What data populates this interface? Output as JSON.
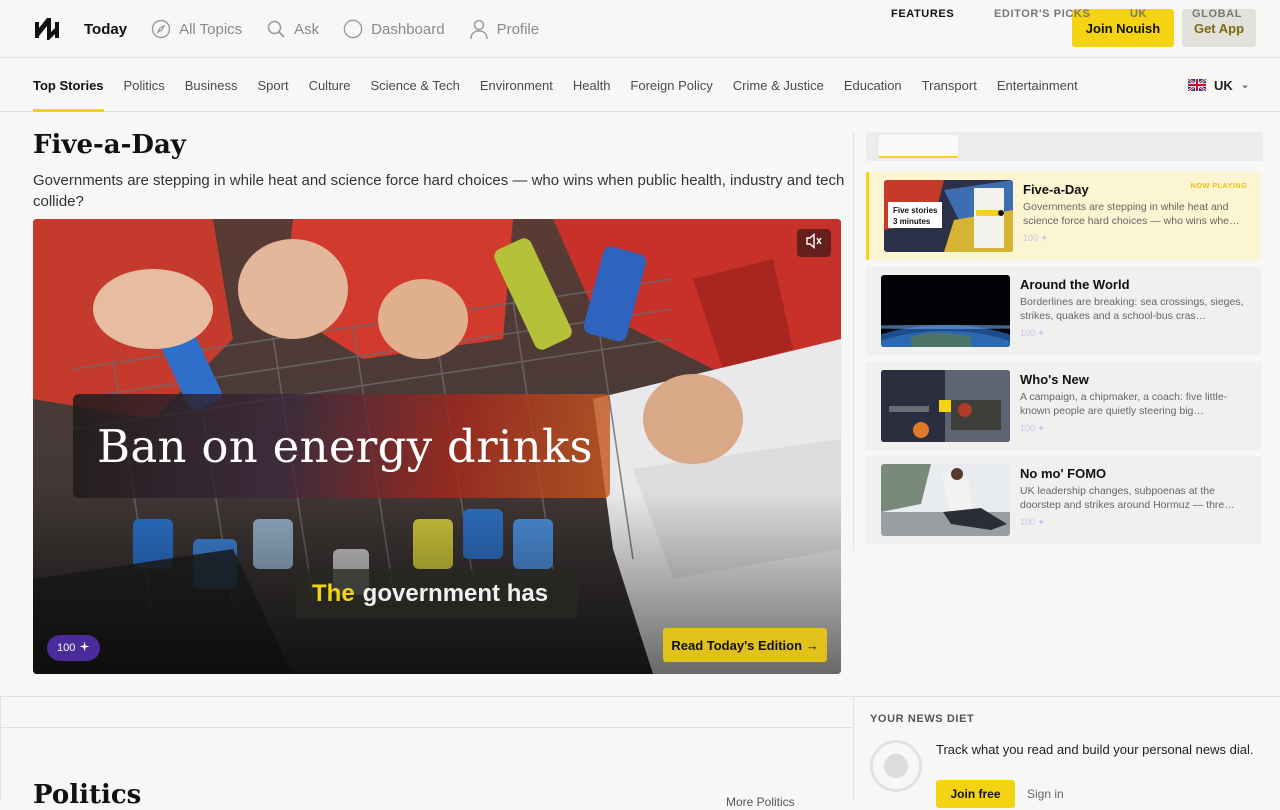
{
  "header": {
    "nav": [
      {
        "label": "Today",
        "icon": "none",
        "active": true
      },
      {
        "label": "All Topics",
        "icon": "compass-icon",
        "active": false
      },
      {
        "label": "Ask",
        "icon": "search-icon",
        "active": false
      },
      {
        "label": "Dashboard",
        "icon": "circle-icon",
        "active": false
      },
      {
        "label": "Profile",
        "icon": "user-icon",
        "active": false
      }
    ],
    "join_label": "Join Nouish",
    "app_label": "Get App"
  },
  "categories": [
    "Top Stories",
    "Politics",
    "Business",
    "Sport",
    "Culture",
    "Science & Tech",
    "Environment",
    "Health",
    "Foreign Policy",
    "Crime & Justice",
    "Education",
    "Transport",
    "Entertainment"
  ],
  "region": {
    "label": "UK",
    "icon": "uk-flag-icon"
  },
  "main": {
    "title": "Five-a-Day",
    "subtitle": "Governments are stepping in while heat and science force hard choices — who wins when public health, industry and tech collide?",
    "video": {
      "headline": "Ban on energy drinks",
      "caption_highlight": "The",
      "caption_rest": "government has",
      "score": "100",
      "read_label": "Read Today's Edition →"
    }
  },
  "sidebar": {
    "tabs": [
      "FEATURES",
      "EDITOR'S PICKS",
      "UK",
      "GLOBAL"
    ],
    "items": [
      {
        "title": "Five-a-Day",
        "desc": "Governments are stepping in while heat and science force hard choices — who wins whe…",
        "score": "100 ✦",
        "now_playing": "NOW PLAYING",
        "thumb_overlay": "Five stories\n3 minutes"
      },
      {
        "title": "Around the World",
        "desc": "Borderlines are breaking: sea crossings, sieges, strikes, quakes and a school-bus cras…",
        "score": "100 ✦"
      },
      {
        "title": "Who's New",
        "desc": "A campaign, a chipmaker, a coach: five little-known people are quietly steering big…",
        "score": "100 ✦"
      },
      {
        "title": "No mo' FOMO",
        "desc": "UK leadership changes, subpoenas at the doorstep and strikes around Hormuz — thre…",
        "score": "100 ✦"
      }
    ]
  },
  "bottom": {
    "section_title": "Politics",
    "more_link": "More Politics",
    "diet_label": "YOUR NEWS DIET",
    "diet_text": "Track what you read and build your personal news dial.",
    "diet_join": "Join free",
    "diet_signin": "Sign in"
  },
  "colors": {
    "accent": "#f4d313",
    "purple": "#4b2a9a"
  }
}
